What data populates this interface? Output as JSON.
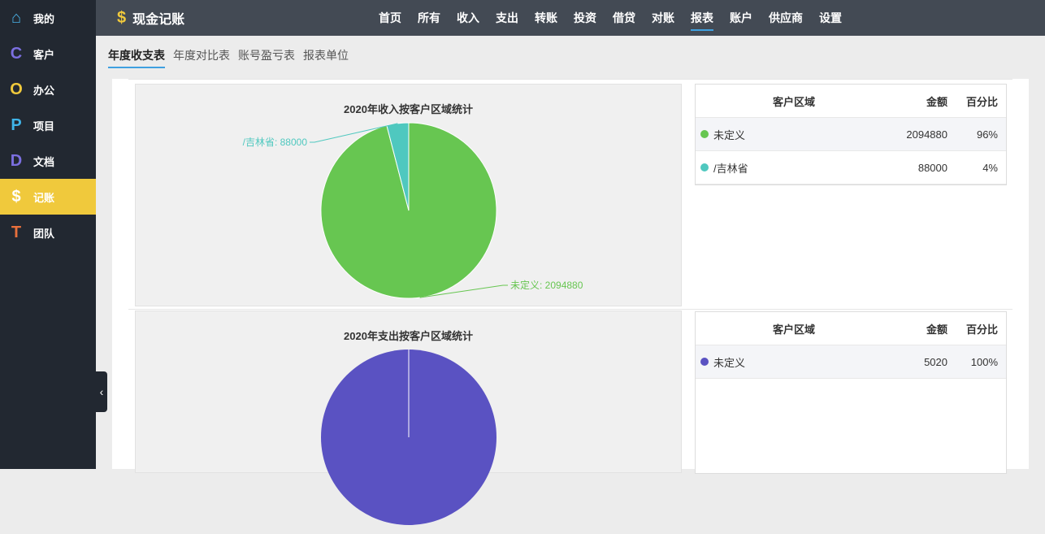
{
  "sidebar": {
    "items": [
      {
        "label": "我的",
        "icon": "home-icon",
        "glyph": "⌂",
        "color": "#4ab3e8"
      },
      {
        "label": "客户",
        "icon": "c-icon",
        "glyph": "C",
        "color": "#7b6fe0"
      },
      {
        "label": "办公",
        "icon": "o-icon",
        "glyph": "O",
        "color": "#f0c93c"
      },
      {
        "label": "项目",
        "icon": "p-icon",
        "glyph": "P",
        "color": "#3fb4e8"
      },
      {
        "label": "文档",
        "icon": "d-icon",
        "glyph": "D",
        "color": "#7b6fe0"
      },
      {
        "label": "记账",
        "icon": "dollar-icon",
        "glyph": "$",
        "color": "#ffffff"
      },
      {
        "label": "团队",
        "icon": "t-icon",
        "glyph": "T",
        "color": "#e8703c"
      }
    ]
  },
  "header": {
    "logo_glyph": "$",
    "title": "现金记账",
    "nav": [
      "首页",
      "所有",
      "收入",
      "支出",
      "转账",
      "投资",
      "借贷",
      "对账",
      "报表",
      "账户",
      "供应商",
      "设置"
    ]
  },
  "subtabs": [
    "年度收支表",
    "年度对比表",
    "账号盈亏表",
    "报表单位"
  ],
  "tables": {
    "headers": [
      "客户区域",
      "金额",
      "百分比"
    ]
  },
  "chart_data": [
    {
      "type": "pie",
      "title": "2020年收入按客户区域统计",
      "labels": [
        "未定义",
        "/吉林省"
      ],
      "values": [
        2094880,
        88000
      ],
      "percents": [
        "96%",
        "4%"
      ],
      "colors": [
        "#67c651",
        "#4fc8bf"
      ],
      "data_labels": [
        "未定义: 2094880",
        "/吉林省: 88000"
      ]
    },
    {
      "type": "pie",
      "title": "2020年支出按客户区域统计",
      "labels": [
        "未定义"
      ],
      "values": [
        5020
      ],
      "percents": [
        "100%"
      ],
      "colors": [
        "#5a52c2"
      ]
    }
  ]
}
